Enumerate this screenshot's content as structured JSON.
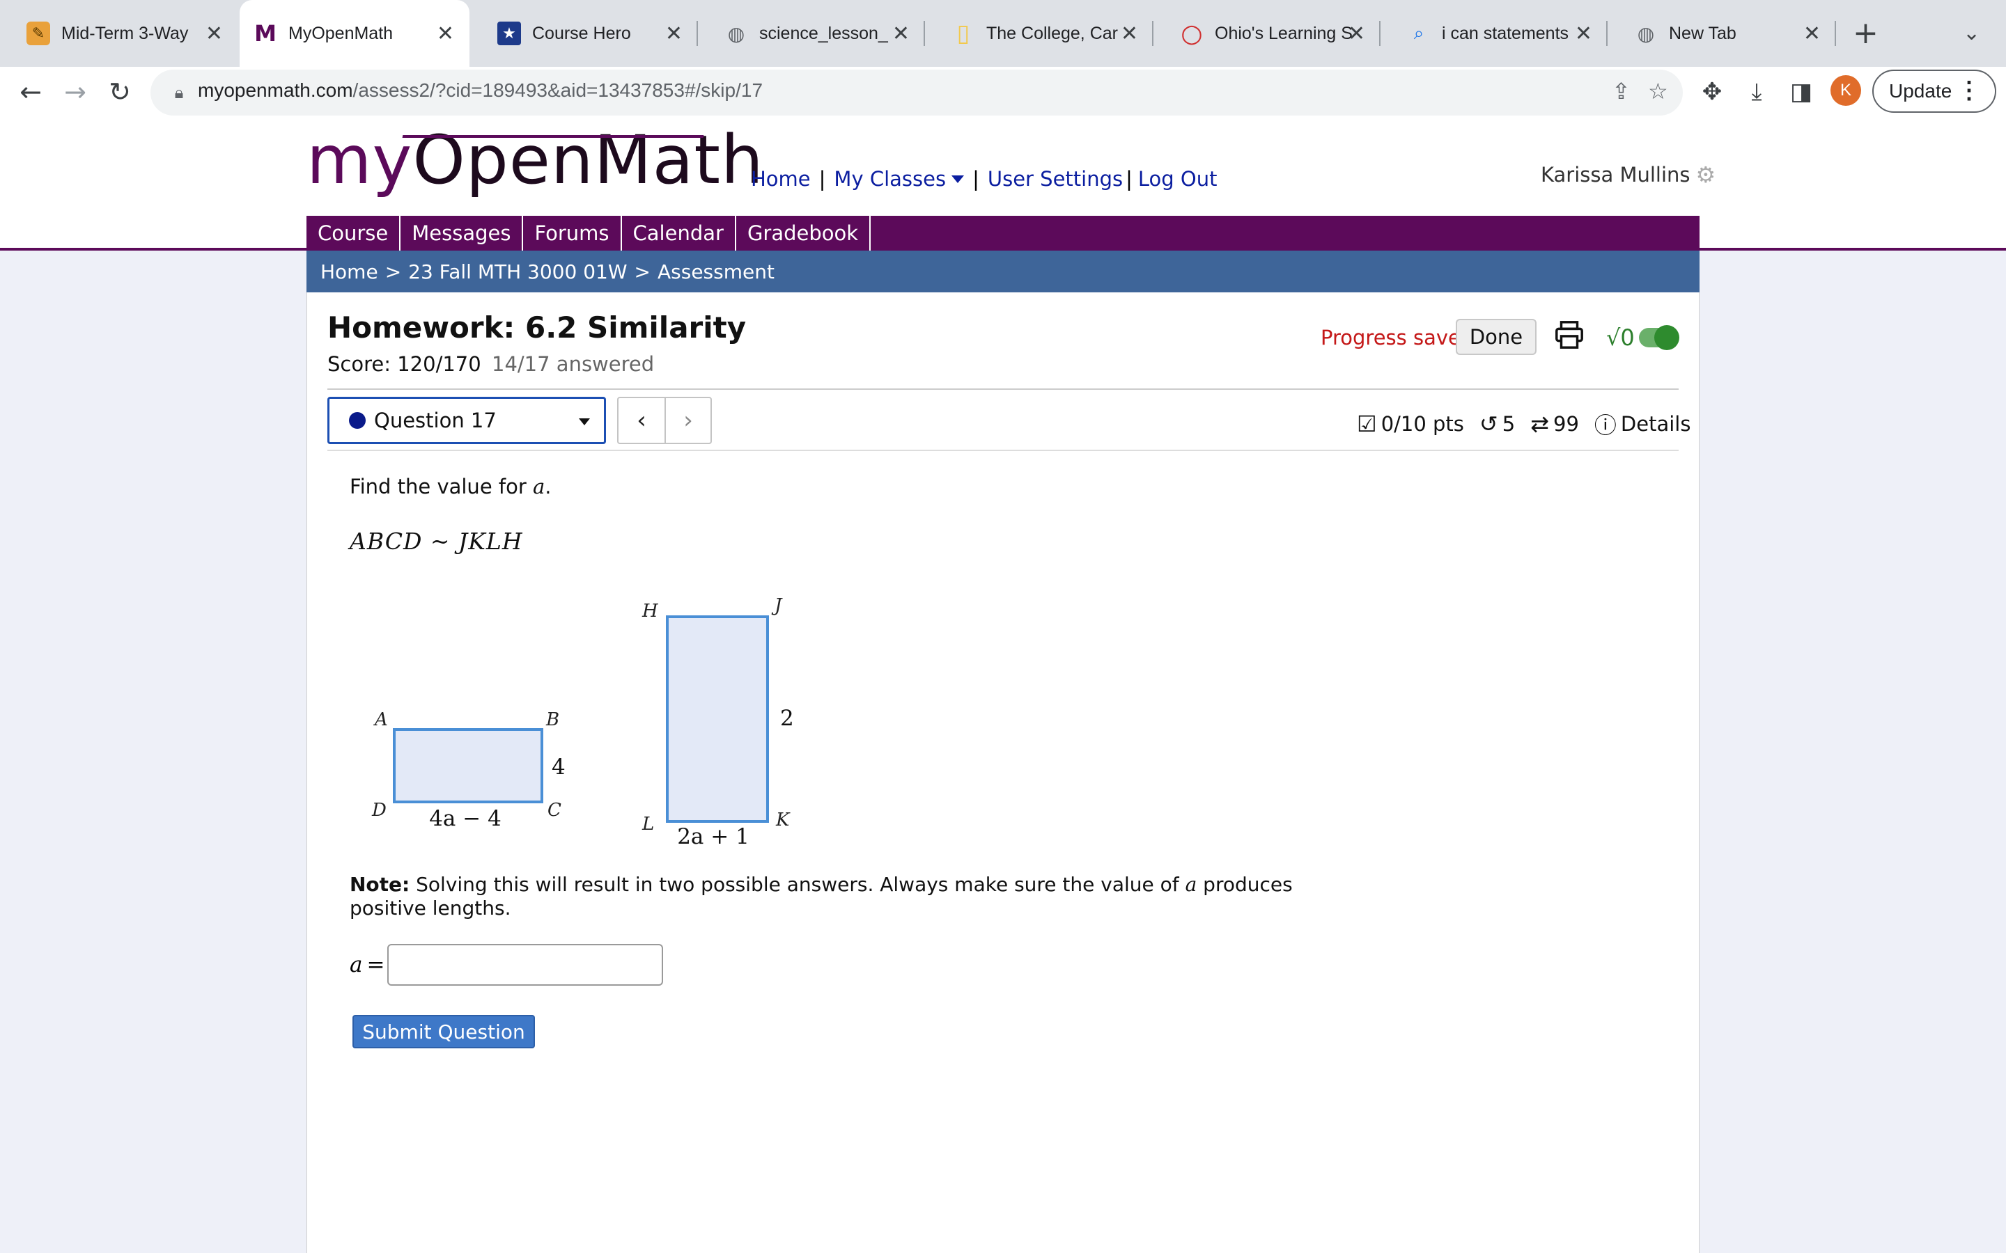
{
  "browser": {
    "tabs": [
      {
        "title": "Mid-Term 3-Way"
      },
      {
        "title": "MyOpenMath"
      },
      {
        "title": "Course Hero"
      },
      {
        "title": "science_lesson_"
      },
      {
        "title": "The College, Car"
      },
      {
        "title": "Ohio's Learning S"
      },
      {
        "title": "i can statements"
      },
      {
        "title": "New Tab"
      }
    ],
    "url_host": "myopenmath.com",
    "url_path": "/assess2/?cid=189493&aid=13437853#/skip/17",
    "profile_initial": "K",
    "update_label": "Update"
  },
  "site": {
    "logo_my": "my",
    "logo_rest": "OpenMath",
    "topnav": {
      "home": "Home",
      "my_classes": "My Classes",
      "user_settings": "User Settings",
      "log_out": "Log Out"
    },
    "username": "Karissa Mullins",
    "course_nav": [
      "Course",
      "Messages",
      "Forums",
      "Calendar",
      "Gradebook"
    ],
    "breadcrumb": {
      "home": "Home",
      "course": "23 Fall MTH 3000 01W",
      "current": "Assessment"
    }
  },
  "assessment": {
    "title": "Homework: 6.2 Similarity",
    "score": "Score: 120/170",
    "answered": "14/17 answered",
    "progress_saved": "Progress saved",
    "done_label": "Done",
    "sqrt_label": "√0",
    "question_select": "Question 17",
    "points": "0/10 pts",
    "retries": "5",
    "regens": "99",
    "details_label": "Details"
  },
  "question": {
    "prompt_prefix": "Find the value for ",
    "prompt_var": "a",
    "prompt_suffix": ".",
    "similarity": "ABCD ~ JKLH",
    "figure": {
      "left_vertices": {
        "a": "A",
        "b": "B",
        "c": "C",
        "d": "D"
      },
      "left_side": "4",
      "left_bottom": "4a − 4",
      "right_vertices": {
        "h": "H",
        "j": "J",
        "k": "K",
        "l": "L"
      },
      "right_side": "2",
      "right_bottom": "2a + 1"
    },
    "note_bold": "Note:",
    "note_text_1": " Solving this will result in two possible answers. Always make sure the value of ",
    "note_var": "a",
    "note_text_2": " produces positive lengths.",
    "answer_label": "a",
    "answer_eq": "=",
    "answer_value": "",
    "submit_label": "Submit Question"
  },
  "colors": {
    "brand_purple": "#5c0a5a",
    "breadcrumb_blue": "#3e6599",
    "link_blue": "#0b1ea0",
    "progress_red": "#c41818",
    "submit_blue": "#3e78c8",
    "shape_fill": "#e3e9f7",
    "shape_stroke": "#4a8fd6"
  }
}
